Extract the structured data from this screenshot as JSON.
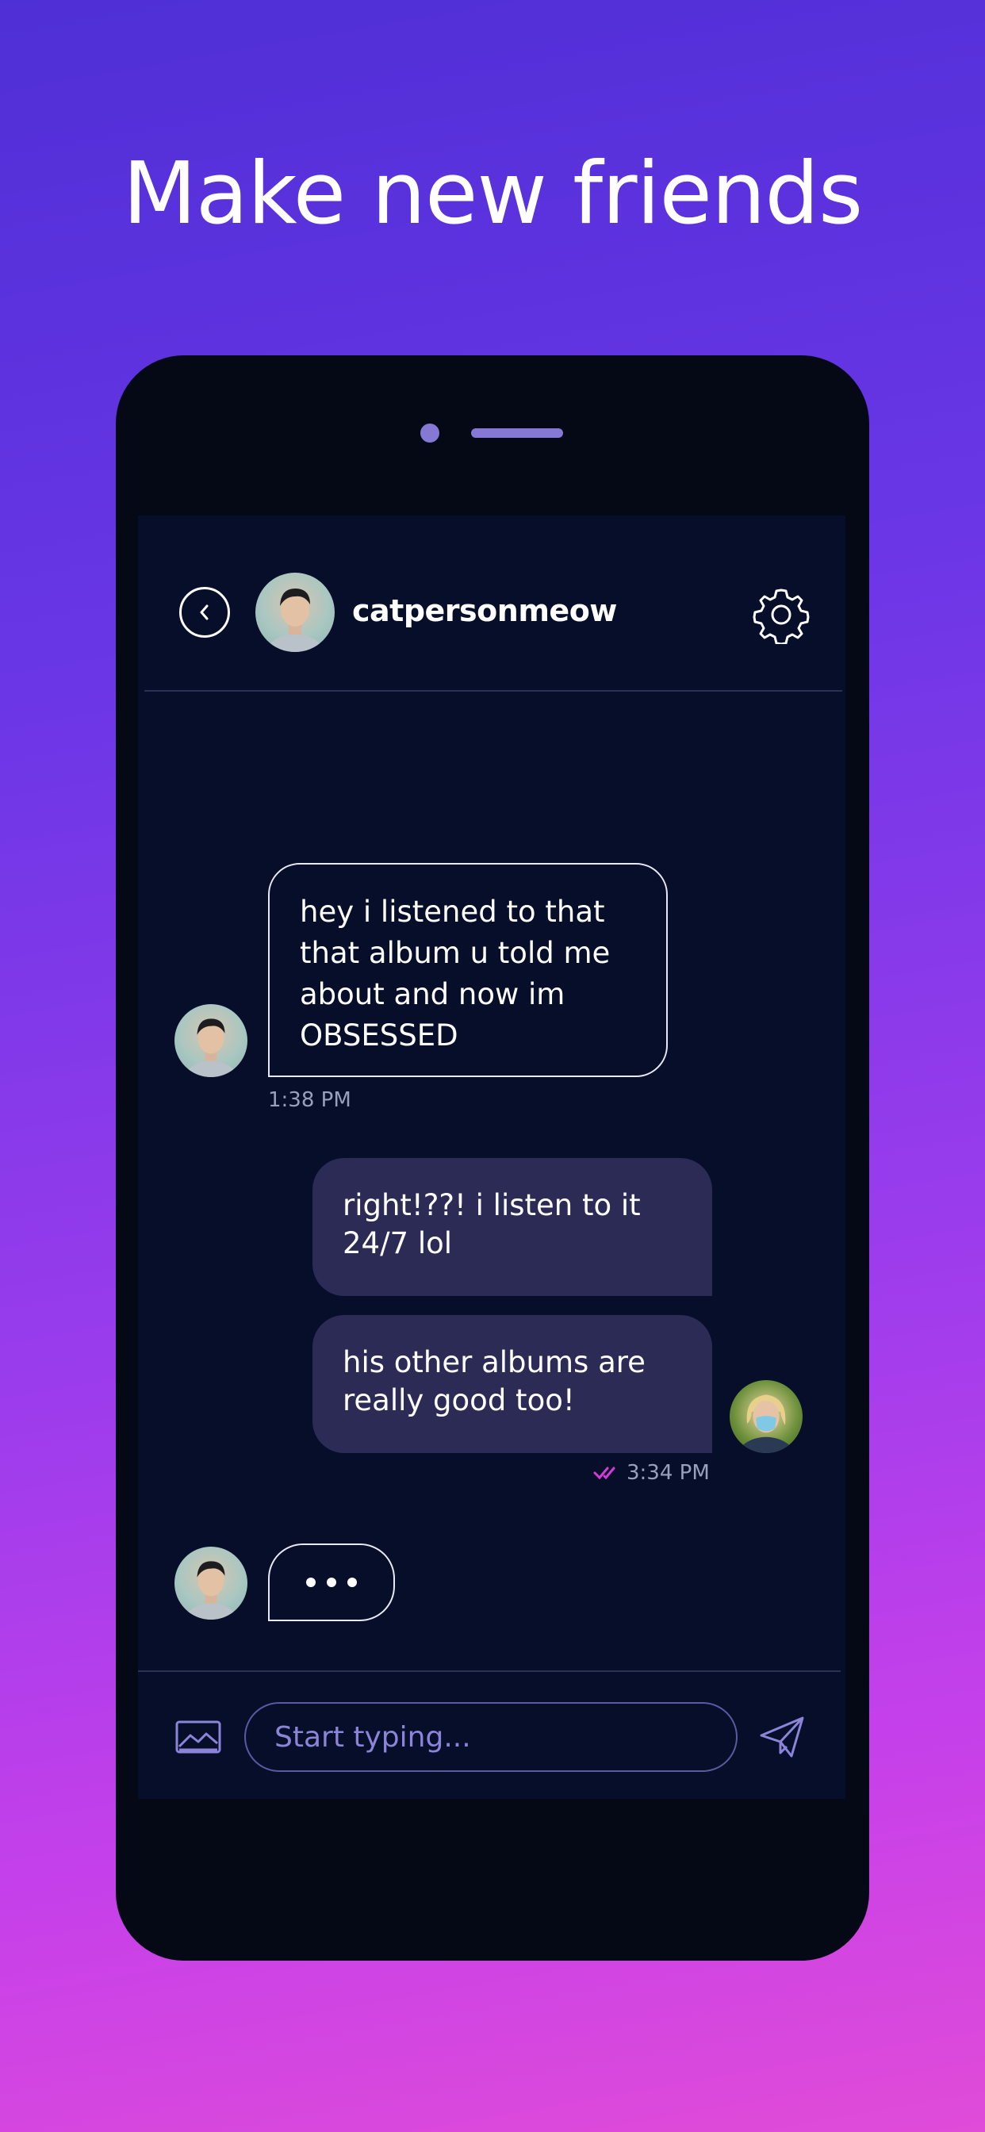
{
  "headline": "Make new friends",
  "chat": {
    "username": "catpersonmeow",
    "messages": [
      {
        "direction": "incoming",
        "text_lines": [
          "hey i listened to that",
          "that album u told me",
          "about and now im",
          "OBSESSED"
        ],
        "time": "1:38 PM"
      },
      {
        "direction": "outgoing",
        "text_lines": [
          "right!??! i listen to it",
          "24/7 lol"
        ]
      },
      {
        "direction": "outgoing",
        "text_lines": [
          "his other albums are",
          "really good too!"
        ],
        "time": "3:34 PM",
        "status": "read"
      }
    ],
    "typing_indicator": "•••"
  },
  "composer": {
    "placeholder": "Start typing...",
    "image_icon": "image-icon",
    "send_icon": "send-icon"
  },
  "colors": {
    "background_top": "#4f2fd6",
    "background_bottom": "#e04bd8",
    "phone_body": "#050915",
    "screen_bg": "#060e2a",
    "outgoing_bubble": "#2b2b55",
    "read_tick": "#d63ad6",
    "placeholder": "#8c84d8"
  }
}
